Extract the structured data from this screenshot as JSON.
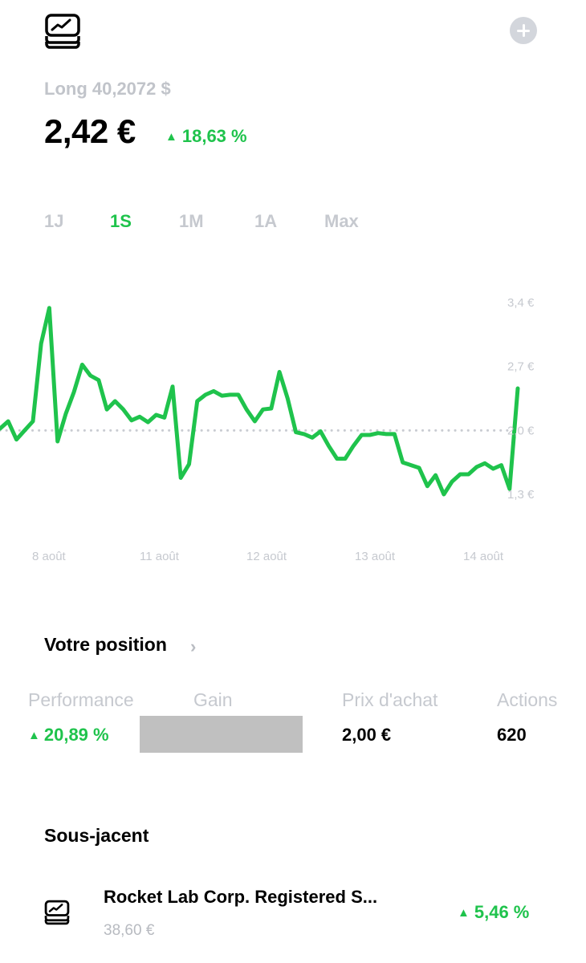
{
  "header": {
    "logo_icon": "stacked-chart-logo-icon",
    "add_icon": "plus-circle-icon"
  },
  "product": {
    "subtitle": "Long 40,2072 $",
    "price": "2,42 €",
    "change": "18,63 %",
    "change_icon": "up-triangle-icon"
  },
  "ranges": [
    {
      "label": "1J",
      "active": false
    },
    {
      "label": "1S",
      "active": true
    },
    {
      "label": "1M",
      "active": false
    },
    {
      "label": "1A",
      "active": false
    },
    {
      "label": "Max",
      "active": false
    }
  ],
  "colors": {
    "accent_green": "#1fc34c",
    "muted_gray": "#c6c9cf",
    "text_black": "#000000"
  },
  "chart_data": {
    "type": "line",
    "reference_line": 2.0,
    "ylim": [
      1.3,
      3.4
    ],
    "y_ticks": [
      3.4,
      2.7,
      2.0,
      1.3
    ],
    "y_tick_labels": [
      "3,4 €",
      "2,7 €",
      "2,0 €",
      "1,3 €"
    ],
    "x_tick_labels": [
      "8 août",
      "11 août",
      "12 août",
      "13 août",
      "14 août"
    ],
    "series": [
      {
        "values": [
          2.02,
          2.1,
          1.9,
          2.0,
          2.1,
          2.95,
          3.34,
          1.88,
          2.18,
          2.42,
          2.72,
          2.6,
          2.55,
          2.23,
          2.32,
          2.23,
          2.11,
          2.15,
          2.09,
          2.17,
          2.14,
          2.48,
          1.48,
          1.63,
          2.32,
          2.39,
          2.43,
          2.38,
          2.39,
          2.39,
          2.23,
          2.1,
          2.23,
          2.24,
          2.64,
          2.35,
          1.98,
          1.96,
          1.92,
          1.99,
          1.83,
          1.69,
          1.69,
          1.83,
          1.95,
          1.95,
          1.97,
          1.96,
          1.96,
          1.65,
          1.62,
          1.59,
          1.39,
          1.51,
          1.3,
          1.44,
          1.52,
          1.52,
          1.6,
          1.64,
          1.58,
          1.62,
          1.36,
          2.46
        ]
      }
    ]
  },
  "position": {
    "title": "Votre position",
    "chevron_icon": "chevron-right-icon",
    "labels": {
      "performance": "Performance",
      "gain": "Gain",
      "purchase_price": "Prix d'achat",
      "shares": "Actions"
    },
    "values": {
      "performance": "20,89 %",
      "purchase_price": "2,00 €",
      "shares": "620"
    }
  },
  "underlying": {
    "title": "Sous-jacent",
    "icon": "stacked-chart-logo-icon",
    "name": "Rocket Lab Corp. Registered S...",
    "price": "38,60 €",
    "change": "5,46 %"
  }
}
